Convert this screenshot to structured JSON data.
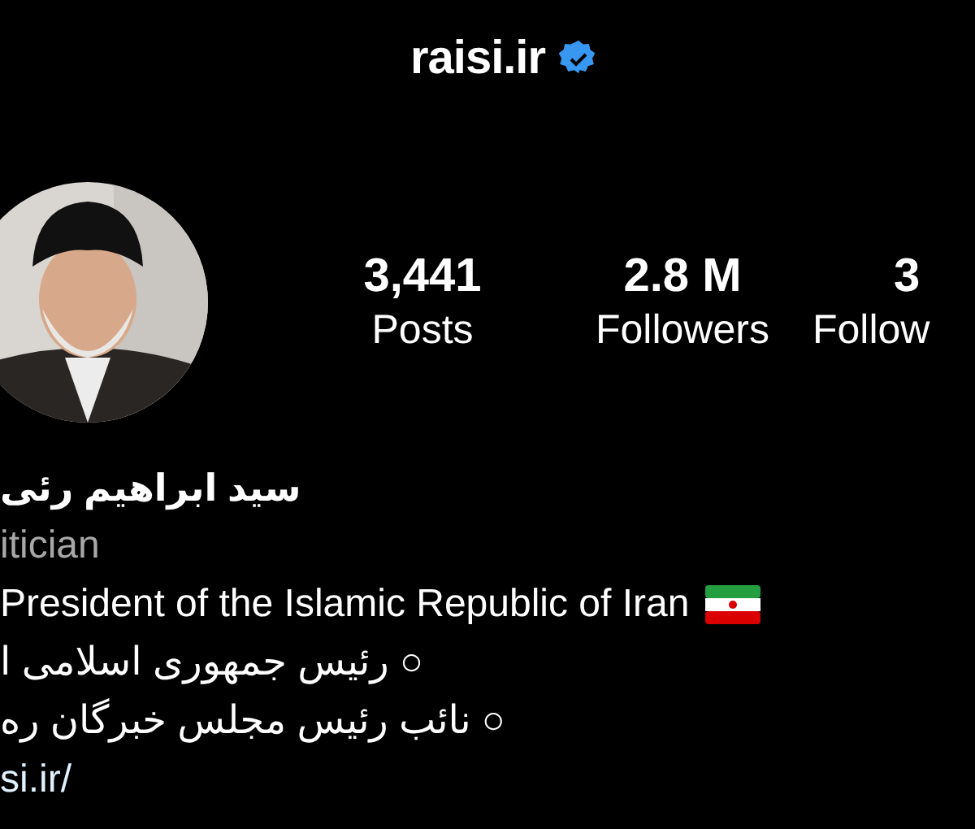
{
  "header": {
    "username": "raisi.ir",
    "verified": true
  },
  "profile": {
    "stats": [
      {
        "value": "3,441",
        "label": "Posts"
      },
      {
        "value": "2.8 M",
        "label": "Followers"
      },
      {
        "value": "3",
        "label": "Follow"
      }
    ]
  },
  "bio": {
    "name": "سید ابراهیم رئی",
    "category": "itician",
    "lines": [
      {
        "text": "President of the Islamic Republic of Iran",
        "kind": "latin",
        "flag": true
      },
      {
        "text": "○ رئیس جمهوری اسلامی ا",
        "kind": "persian",
        "flag": false
      },
      {
        "text": "○ نائب رئیس مجلس خبرگان ره",
        "kind": "persian",
        "flag": false
      }
    ],
    "link": "si.ir/"
  }
}
